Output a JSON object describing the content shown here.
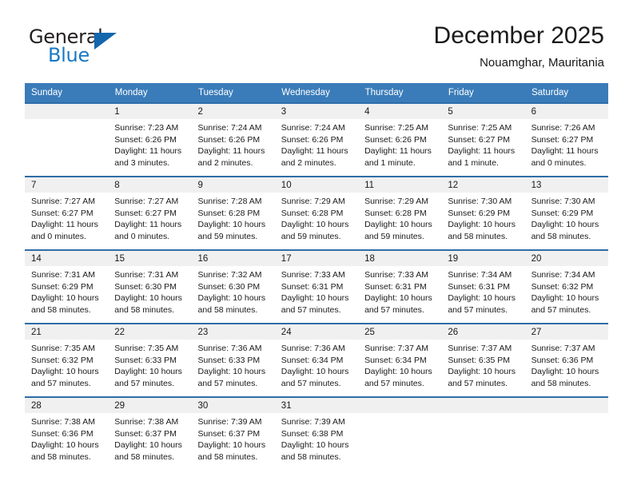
{
  "brand": {
    "name_top": "General",
    "name_bottom": "Blue",
    "triangle_icon": "triangle-icon",
    "accent_color": "#1878c4",
    "dark_color": "#231f20"
  },
  "header": {
    "title": "December 2025",
    "subtitle": "Nouamghar, Mauritania"
  },
  "colors": {
    "header_blue": "#3a7cb9",
    "row_rule_blue": "#2f6da8",
    "daynum_band": "#f0f0f0"
  },
  "weekday_headers": [
    "Sunday",
    "Monday",
    "Tuesday",
    "Wednesday",
    "Thursday",
    "Friday",
    "Saturday"
  ],
  "weeks": [
    [
      {
        "day": "",
        "lines": []
      },
      {
        "day": "1",
        "lines": [
          "Sunrise: 7:23 AM",
          "Sunset: 6:26 PM",
          "Daylight: 11 hours",
          "and 3 minutes."
        ]
      },
      {
        "day": "2",
        "lines": [
          "Sunrise: 7:24 AM",
          "Sunset: 6:26 PM",
          "Daylight: 11 hours",
          "and 2 minutes."
        ]
      },
      {
        "day": "3",
        "lines": [
          "Sunrise: 7:24 AM",
          "Sunset: 6:26 PM",
          "Daylight: 11 hours",
          "and 2 minutes."
        ]
      },
      {
        "day": "4",
        "lines": [
          "Sunrise: 7:25 AM",
          "Sunset: 6:26 PM",
          "Daylight: 11 hours",
          "and 1 minute."
        ]
      },
      {
        "day": "5",
        "lines": [
          "Sunrise: 7:25 AM",
          "Sunset: 6:27 PM",
          "Daylight: 11 hours",
          "and 1 minute."
        ]
      },
      {
        "day": "6",
        "lines": [
          "Sunrise: 7:26 AM",
          "Sunset: 6:27 PM",
          "Daylight: 11 hours",
          "and 0 minutes."
        ]
      }
    ],
    [
      {
        "day": "7",
        "lines": [
          "Sunrise: 7:27 AM",
          "Sunset: 6:27 PM",
          "Daylight: 11 hours",
          "and 0 minutes."
        ]
      },
      {
        "day": "8",
        "lines": [
          "Sunrise: 7:27 AM",
          "Sunset: 6:27 PM",
          "Daylight: 11 hours",
          "and 0 minutes."
        ]
      },
      {
        "day": "9",
        "lines": [
          "Sunrise: 7:28 AM",
          "Sunset: 6:28 PM",
          "Daylight: 10 hours",
          "and 59 minutes."
        ]
      },
      {
        "day": "10",
        "lines": [
          "Sunrise: 7:29 AM",
          "Sunset: 6:28 PM",
          "Daylight: 10 hours",
          "and 59 minutes."
        ]
      },
      {
        "day": "11",
        "lines": [
          "Sunrise: 7:29 AM",
          "Sunset: 6:28 PM",
          "Daylight: 10 hours",
          "and 59 minutes."
        ]
      },
      {
        "day": "12",
        "lines": [
          "Sunrise: 7:30 AM",
          "Sunset: 6:29 PM",
          "Daylight: 10 hours",
          "and 58 minutes."
        ]
      },
      {
        "day": "13",
        "lines": [
          "Sunrise: 7:30 AM",
          "Sunset: 6:29 PM",
          "Daylight: 10 hours",
          "and 58 minutes."
        ]
      }
    ],
    [
      {
        "day": "14",
        "lines": [
          "Sunrise: 7:31 AM",
          "Sunset: 6:29 PM",
          "Daylight: 10 hours",
          "and 58 minutes."
        ]
      },
      {
        "day": "15",
        "lines": [
          "Sunrise: 7:31 AM",
          "Sunset: 6:30 PM",
          "Daylight: 10 hours",
          "and 58 minutes."
        ]
      },
      {
        "day": "16",
        "lines": [
          "Sunrise: 7:32 AM",
          "Sunset: 6:30 PM",
          "Daylight: 10 hours",
          "and 58 minutes."
        ]
      },
      {
        "day": "17",
        "lines": [
          "Sunrise: 7:33 AM",
          "Sunset: 6:31 PM",
          "Daylight: 10 hours",
          "and 57 minutes."
        ]
      },
      {
        "day": "18",
        "lines": [
          "Sunrise: 7:33 AM",
          "Sunset: 6:31 PM",
          "Daylight: 10 hours",
          "and 57 minutes."
        ]
      },
      {
        "day": "19",
        "lines": [
          "Sunrise: 7:34 AM",
          "Sunset: 6:31 PM",
          "Daylight: 10 hours",
          "and 57 minutes."
        ]
      },
      {
        "day": "20",
        "lines": [
          "Sunrise: 7:34 AM",
          "Sunset: 6:32 PM",
          "Daylight: 10 hours",
          "and 57 minutes."
        ]
      }
    ],
    [
      {
        "day": "21",
        "lines": [
          "Sunrise: 7:35 AM",
          "Sunset: 6:32 PM",
          "Daylight: 10 hours",
          "and 57 minutes."
        ]
      },
      {
        "day": "22",
        "lines": [
          "Sunrise: 7:35 AM",
          "Sunset: 6:33 PM",
          "Daylight: 10 hours",
          "and 57 minutes."
        ]
      },
      {
        "day": "23",
        "lines": [
          "Sunrise: 7:36 AM",
          "Sunset: 6:33 PM",
          "Daylight: 10 hours",
          "and 57 minutes."
        ]
      },
      {
        "day": "24",
        "lines": [
          "Sunrise: 7:36 AM",
          "Sunset: 6:34 PM",
          "Daylight: 10 hours",
          "and 57 minutes."
        ]
      },
      {
        "day": "25",
        "lines": [
          "Sunrise: 7:37 AM",
          "Sunset: 6:34 PM",
          "Daylight: 10 hours",
          "and 57 minutes."
        ]
      },
      {
        "day": "26",
        "lines": [
          "Sunrise: 7:37 AM",
          "Sunset: 6:35 PM",
          "Daylight: 10 hours",
          "and 57 minutes."
        ]
      },
      {
        "day": "27",
        "lines": [
          "Sunrise: 7:37 AM",
          "Sunset: 6:36 PM",
          "Daylight: 10 hours",
          "and 58 minutes."
        ]
      }
    ],
    [
      {
        "day": "28",
        "lines": [
          "Sunrise: 7:38 AM",
          "Sunset: 6:36 PM",
          "Daylight: 10 hours",
          "and 58 minutes."
        ]
      },
      {
        "day": "29",
        "lines": [
          "Sunrise: 7:38 AM",
          "Sunset: 6:37 PM",
          "Daylight: 10 hours",
          "and 58 minutes."
        ]
      },
      {
        "day": "30",
        "lines": [
          "Sunrise: 7:39 AM",
          "Sunset: 6:37 PM",
          "Daylight: 10 hours",
          "and 58 minutes."
        ]
      },
      {
        "day": "31",
        "lines": [
          "Sunrise: 7:39 AM",
          "Sunset: 6:38 PM",
          "Daylight: 10 hours",
          "and 58 minutes."
        ]
      },
      {
        "day": "",
        "lines": []
      },
      {
        "day": "",
        "lines": []
      },
      {
        "day": "",
        "lines": []
      }
    ]
  ]
}
